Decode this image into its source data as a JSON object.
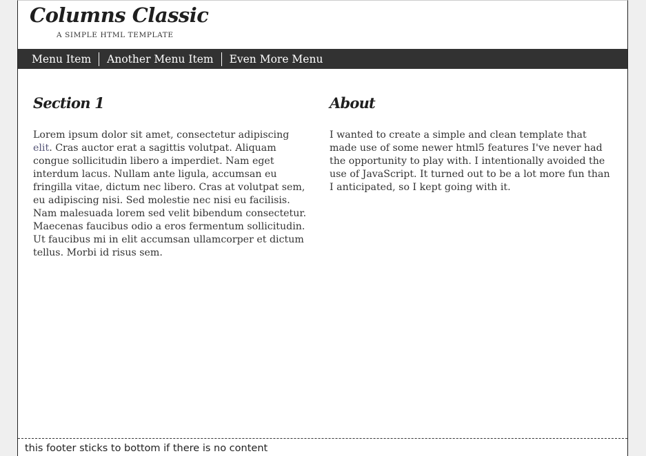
{
  "header": {
    "title": "Columns Classic",
    "tagline": "A SIMPLE HTML TEMPLATE"
  },
  "nav": {
    "items": [
      "Menu Item",
      "Another Menu Item",
      "Even More Menu"
    ]
  },
  "section1": {
    "heading": "Section 1",
    "text_before_link": "Lorem ipsum dolor sit amet, consectetur adipiscing ",
    "link_text": "elit",
    "text_after_link": ". Cras auctor erat a sagittis volutpat. Aliquam congue sollicitudin libero a imperdiet. Nam eget interdum lacus. Nullam ante ligula, accumsan eu fringilla vitae, dictum nec libero. Cras at volutpat sem, eu adipiscing nisi. Sed molestie nec nisi eu facilisis. Nam malesuada lorem sed velit bibendum consectetur. Maecenas faucibus odio a eros fermentum sollicitudin. Ut faucibus mi in elit accumsan ullamcorper et dictum tellus. Morbi id risus sem."
  },
  "about": {
    "heading": "About",
    "text": "I wanted to create a simple and clean template that made use of some newer html5 features I've never had the opportunity to play with. I intentionally avoided the use of JavaScript. It turned out to be a lot more fun than I anticipated, so I kept going with it."
  },
  "footer": {
    "text": "this footer sticks to bottom if there is no content"
  },
  "colors": {
    "nav_background": "#323232",
    "page_background": "#efefef",
    "content_background": "#ffffff"
  }
}
